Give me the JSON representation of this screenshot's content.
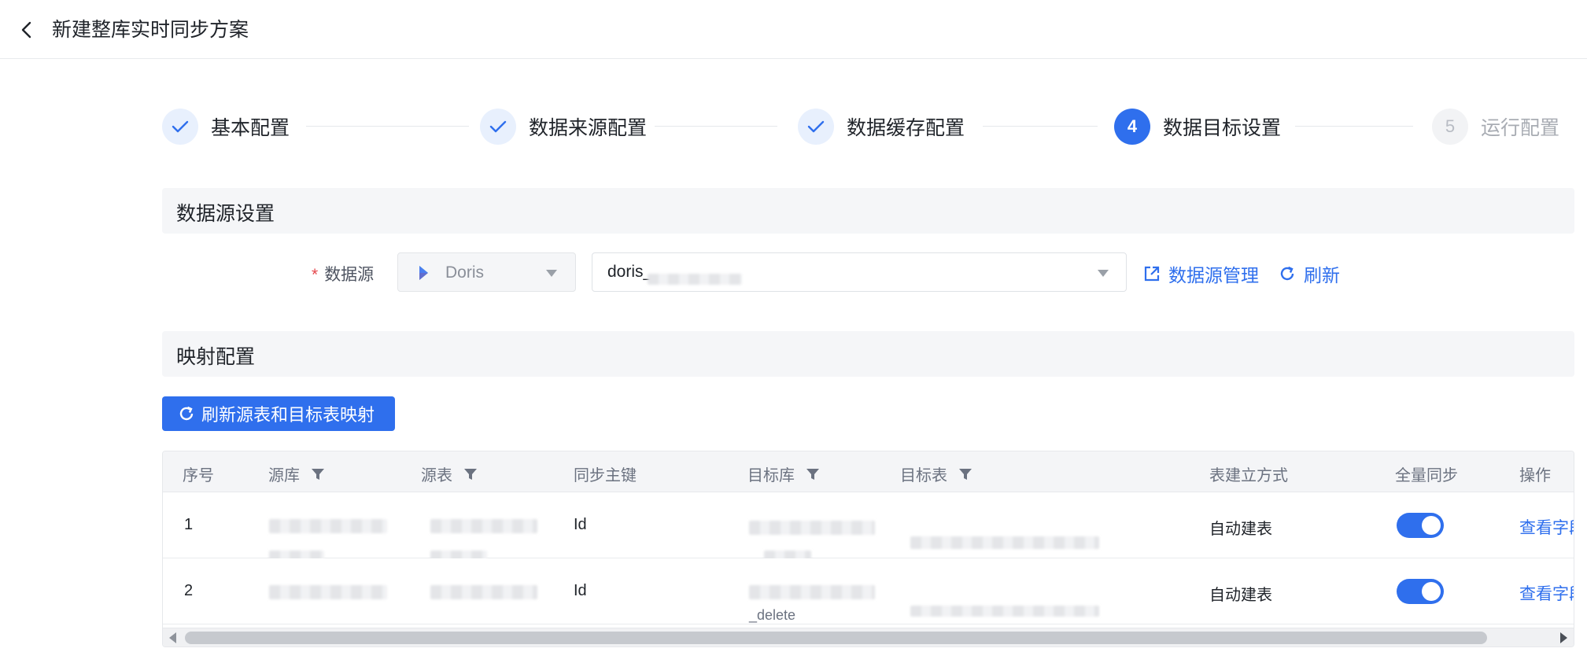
{
  "header": {
    "title": "新建整库实时同步方案"
  },
  "steps": [
    {
      "index": "1",
      "label": "基本配置",
      "state": "done"
    },
    {
      "index": "2",
      "label": "数据来源配置",
      "state": "done"
    },
    {
      "index": "3",
      "label": "数据缓存配置",
      "state": "done"
    },
    {
      "index": "4",
      "label": "数据目标设置",
      "state": "active"
    },
    {
      "index": "5",
      "label": "运行配置",
      "state": "todo"
    }
  ],
  "datasource_section": {
    "title": "数据源设置",
    "label": "数据源",
    "required_mark": "*",
    "type_value": "Doris",
    "connection_value": "doris_",
    "manage_link": "数据源管理",
    "refresh_link": "刷新"
  },
  "mapping_section": {
    "title": "映射配置",
    "refresh_button": "刷新源表和目标表映射"
  },
  "table": {
    "columns": [
      "序号",
      "源库",
      "源表",
      "同步主键",
      "目标库",
      "目标表",
      "表建立方式",
      "全量同步",
      "操作"
    ],
    "rows": [
      {
        "index": "1",
        "primary_key": "Id",
        "creation": "自动建表",
        "full_sync": true,
        "action": "查看字段"
      },
      {
        "index": "2",
        "primary_key": "Id",
        "creation": "自动建表",
        "full_sync": true,
        "action": "查看字段",
        "target_db_suffix": "_delete"
      }
    ]
  },
  "colors": {
    "primary": "#2f6fed",
    "required": "#e5484d"
  }
}
